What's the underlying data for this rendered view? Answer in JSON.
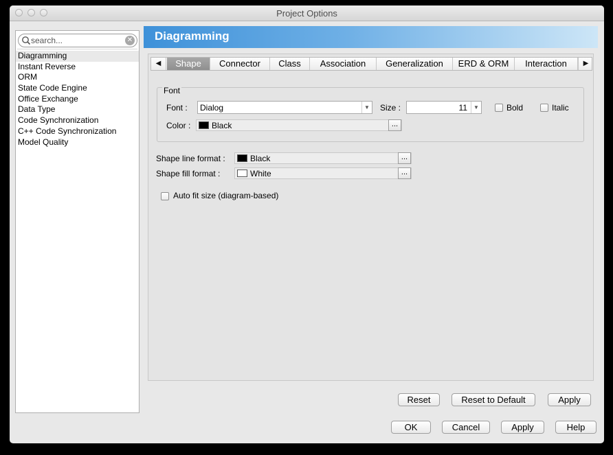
{
  "window": {
    "title": "Project Options"
  },
  "sidebar": {
    "search_placeholder": "search...",
    "items": [
      {
        "label": "Diagramming",
        "selected": true
      },
      {
        "label": "Instant Reverse"
      },
      {
        "label": "ORM"
      },
      {
        "label": "State Code Engine"
      },
      {
        "label": "Office Exchange"
      },
      {
        "label": "Data Type"
      },
      {
        "label": "Code Synchronization"
      },
      {
        "label": "C++ Code Synchronization"
      },
      {
        "label": "Model Quality"
      }
    ]
  },
  "header": {
    "title": "Diagramming"
  },
  "tabs": {
    "prev_icon": "left-triangle-icon",
    "next_icon": "right-triangle-icon",
    "items": [
      {
        "label": "Shape",
        "active": true
      },
      {
        "label": "Connector"
      },
      {
        "label": "Class"
      },
      {
        "label": "Association"
      },
      {
        "label": "Generalization"
      },
      {
        "label": "ERD & ORM"
      },
      {
        "label": "Interaction"
      }
    ]
  },
  "font_group": {
    "legend": "Font",
    "font_label": "Font :",
    "font_value": "Dialog",
    "size_label": "Size :",
    "size_value": "11",
    "bold_label": "Bold",
    "bold_checked": false,
    "italic_label": "Italic",
    "italic_checked": false,
    "color_label": "Color :",
    "color_value": "Black",
    "color_hex": "#000000",
    "more_label": "..."
  },
  "shape": {
    "line_label": "Shape line format :",
    "line_value": "Black",
    "line_hex": "#000000",
    "fill_label": "Shape fill format :",
    "fill_value": "White",
    "fill_hex": "#ffffff",
    "more_label": "...",
    "autofit_label": "Auto fit size (diagram-based)",
    "autofit_checked": false
  },
  "panel_buttons": {
    "reset": "Reset",
    "reset_default": "Reset to Default",
    "apply": "Apply"
  },
  "dialog_buttons": {
    "ok": "OK",
    "cancel": "Cancel",
    "apply": "Apply",
    "help": "Help"
  },
  "colors": {
    "banner_start": "#3e91d9",
    "banner_end": "#cde6f7",
    "active_tab": "#999999"
  }
}
